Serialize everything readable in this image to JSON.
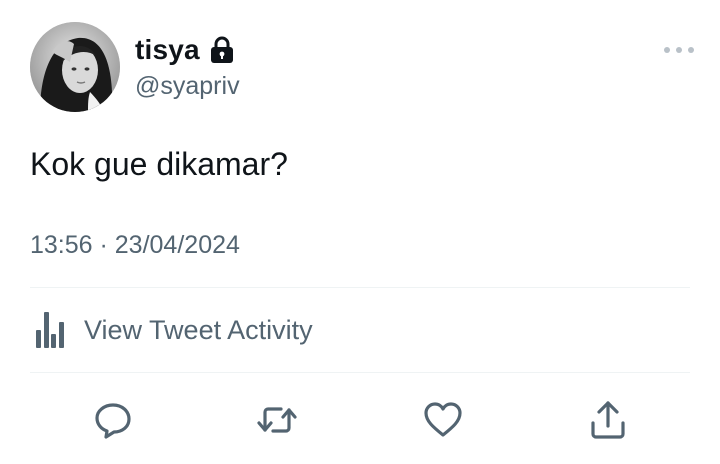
{
  "user": {
    "display_name": "tisya",
    "handle": "@syapriv",
    "avatar_icon": "profile-photo",
    "protected_icon": "lock-icon"
  },
  "tweet": {
    "text": "Kok gue dikamar?",
    "timestamp": "13:56 · 23/04/2024"
  },
  "activity": {
    "label": "View Tweet Activity",
    "icon": "bar-chart-icon"
  },
  "actions": {
    "reply_icon": "reply-icon",
    "retweet_icon": "retweet-icon",
    "like_icon": "heart-icon",
    "share_icon": "share-icon"
  },
  "colors": {
    "text_primary": "#0f1419",
    "text_secondary": "#536471",
    "divider": "#eff3f4"
  }
}
